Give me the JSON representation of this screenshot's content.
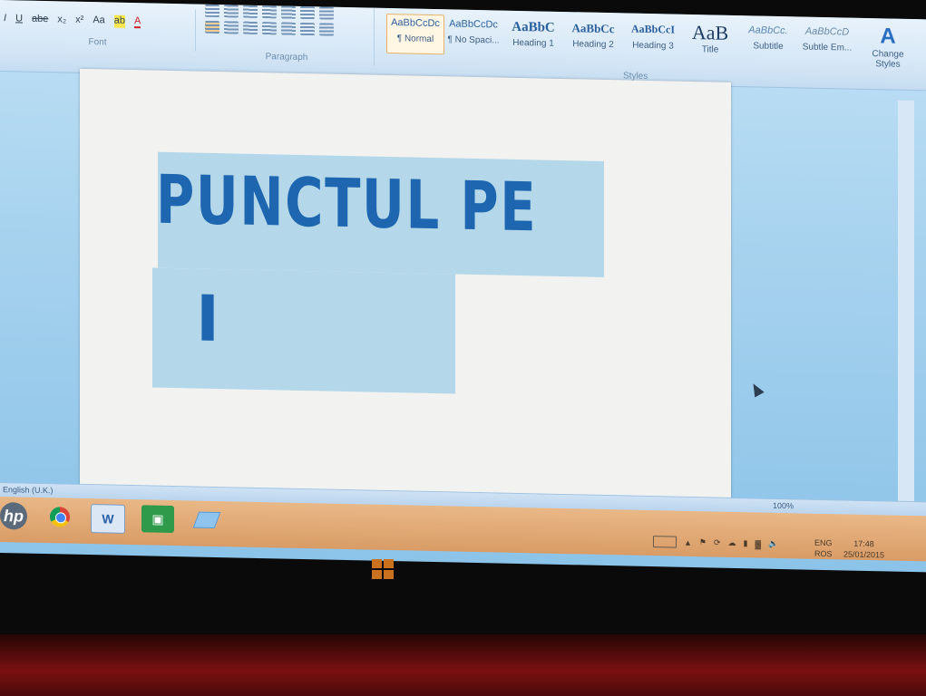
{
  "ribbon": {
    "font_group": {
      "label": "Font",
      "buttons": [
        "I",
        "U",
        "abe",
        "x₂",
        "x²",
        "Aa",
        "ab",
        "A"
      ]
    },
    "paragraph_group": {
      "label": "Paragraph"
    },
    "styles_group": {
      "label": "Styles",
      "items": [
        {
          "preview": "AaBbCcDc",
          "name": "¶ Normal"
        },
        {
          "preview": "AaBbCcDc",
          "name": "¶ No Spaci..."
        },
        {
          "preview": "AaBbC",
          "name": "Heading 1"
        },
        {
          "preview": "AaBbCc",
          "name": "Heading 2"
        },
        {
          "preview": "AaBbCcI",
          "name": "Heading 3"
        },
        {
          "preview": "AaB",
          "name": "Title"
        },
        {
          "preview": "AaBbCc.",
          "name": "Subtitle"
        },
        {
          "preview": "AaBbCcD",
          "name": "Subtle Em..."
        }
      ],
      "change_styles": {
        "icon": "A",
        "label_line1": "Change",
        "label_line2": "Styles"
      }
    }
  },
  "document": {
    "line1": "PUNCTUL PE",
    "line2": "I"
  },
  "statusbar": {
    "language": "English (U.K.)",
    "zoom": "100%"
  },
  "taskbar": {
    "hp": "hp",
    "word": "W",
    "tray": {
      "lang_line1": "ENG",
      "lang_line2": "ROS",
      "time": "17:48",
      "date": "25/01/2015"
    }
  },
  "colors": {
    "accent": "#1e66b0",
    "selection": "#b4d8ea",
    "taskbar": "#d99c66"
  }
}
